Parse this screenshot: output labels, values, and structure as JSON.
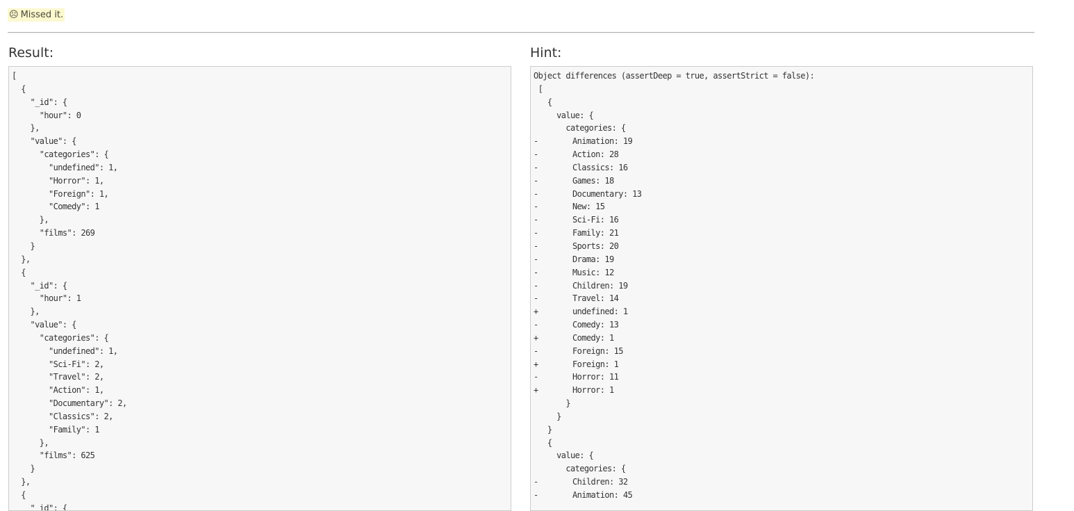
{
  "status": {
    "icon": "frown-face-icon",
    "face": "☹",
    "text": "Missed it."
  },
  "result": {
    "title": "Result:",
    "lines": [
      "[",
      "  {",
      "    \"_id\": {",
      "      \"hour\": 0",
      "    },",
      "    \"value\": {",
      "      \"categories\": {",
      "        \"undefined\": 1,",
      "        \"Horror\": 1,",
      "        \"Foreign\": 1,",
      "        \"Comedy\": 1",
      "      },",
      "      \"films\": 269",
      "    }",
      "  },",
      "  {",
      "    \"_id\": {",
      "      \"hour\": 1",
      "    },",
      "    \"value\": {",
      "      \"categories\": {",
      "        \"undefined\": 1,",
      "        \"Sci-Fi\": 2,",
      "        \"Travel\": 2,",
      "        \"Action\": 1,",
      "        \"Documentary\": 2,",
      "        \"Classics\": 2,",
      "        \"Family\": 1",
      "      },",
      "      \"films\": 625",
      "    }",
      "  },",
      "  {",
      "    \"_id\": {"
    ]
  },
  "hint": {
    "title": "Hint:",
    "header": "Object differences (assertDeep = true, assertStrict = false):",
    "lines": [
      {
        "mark": "",
        "text": " ["
      },
      {
        "mark": "",
        "text": "   {"
      },
      {
        "mark": "",
        "text": "     value: {"
      },
      {
        "mark": "",
        "text": "       categories: {"
      },
      {
        "mark": "-",
        "text": "Animation: 19"
      },
      {
        "mark": "-",
        "text": "Action: 28"
      },
      {
        "mark": "-",
        "text": "Classics: 16"
      },
      {
        "mark": "-",
        "text": "Games: 18"
      },
      {
        "mark": "-",
        "text": "Documentary: 13"
      },
      {
        "mark": "-",
        "text": "New: 15"
      },
      {
        "mark": "-",
        "text": "Sci-Fi: 16"
      },
      {
        "mark": "-",
        "text": "Family: 21"
      },
      {
        "mark": "-",
        "text": "Sports: 20"
      },
      {
        "mark": "-",
        "text": "Drama: 19"
      },
      {
        "mark": "-",
        "text": "Music: 12"
      },
      {
        "mark": "-",
        "text": "Children: 19"
      },
      {
        "mark": "-",
        "text": "Travel: 14"
      },
      {
        "mark": "+",
        "text": "undefined: 1"
      },
      {
        "mark": "-",
        "text": "Comedy: 13"
      },
      {
        "mark": "+",
        "text": "Comedy: 1"
      },
      {
        "mark": "-",
        "text": "Foreign: 15"
      },
      {
        "mark": "+",
        "text": "Foreign: 1"
      },
      {
        "mark": "-",
        "text": "Horror: 11"
      },
      {
        "mark": "+",
        "text": "Horror: 1"
      },
      {
        "mark": "",
        "text": "       }"
      },
      {
        "mark": "",
        "text": "     }"
      },
      {
        "mark": "",
        "text": "   }"
      },
      {
        "mark": "",
        "text": "   {"
      },
      {
        "mark": "",
        "text": "     value: {"
      },
      {
        "mark": "",
        "text": "       categories: {"
      },
      {
        "mark": "-",
        "text": "Children: 32"
      },
      {
        "mark": "-",
        "text": "Animation: 45"
      }
    ]
  }
}
